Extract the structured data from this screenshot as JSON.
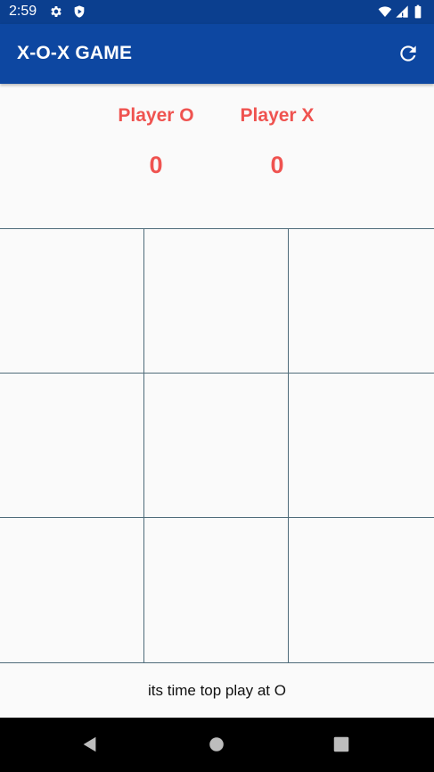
{
  "status_bar": {
    "time": "2:59",
    "icons": [
      "gear-icon",
      "shield-play-icon",
      "wifi-icon",
      "signal-icon",
      "battery-icon"
    ]
  },
  "app_bar": {
    "title": "X-O-X GAME",
    "refresh_icon": "refresh-icon",
    "background": "#0d47a1"
  },
  "scoreboard": {
    "players": [
      {
        "label": "Player O",
        "score": "0"
      },
      {
        "label": "Player X",
        "score": "0"
      }
    ],
    "accent": "#ef5350"
  },
  "board": {
    "cells": [
      "",
      "",
      "",
      "",
      "",
      "",
      "",
      "",
      ""
    ]
  },
  "message": "its time top play at O",
  "nav_bar": {
    "icons": [
      "back-icon",
      "home-icon",
      "recents-icon"
    ]
  }
}
